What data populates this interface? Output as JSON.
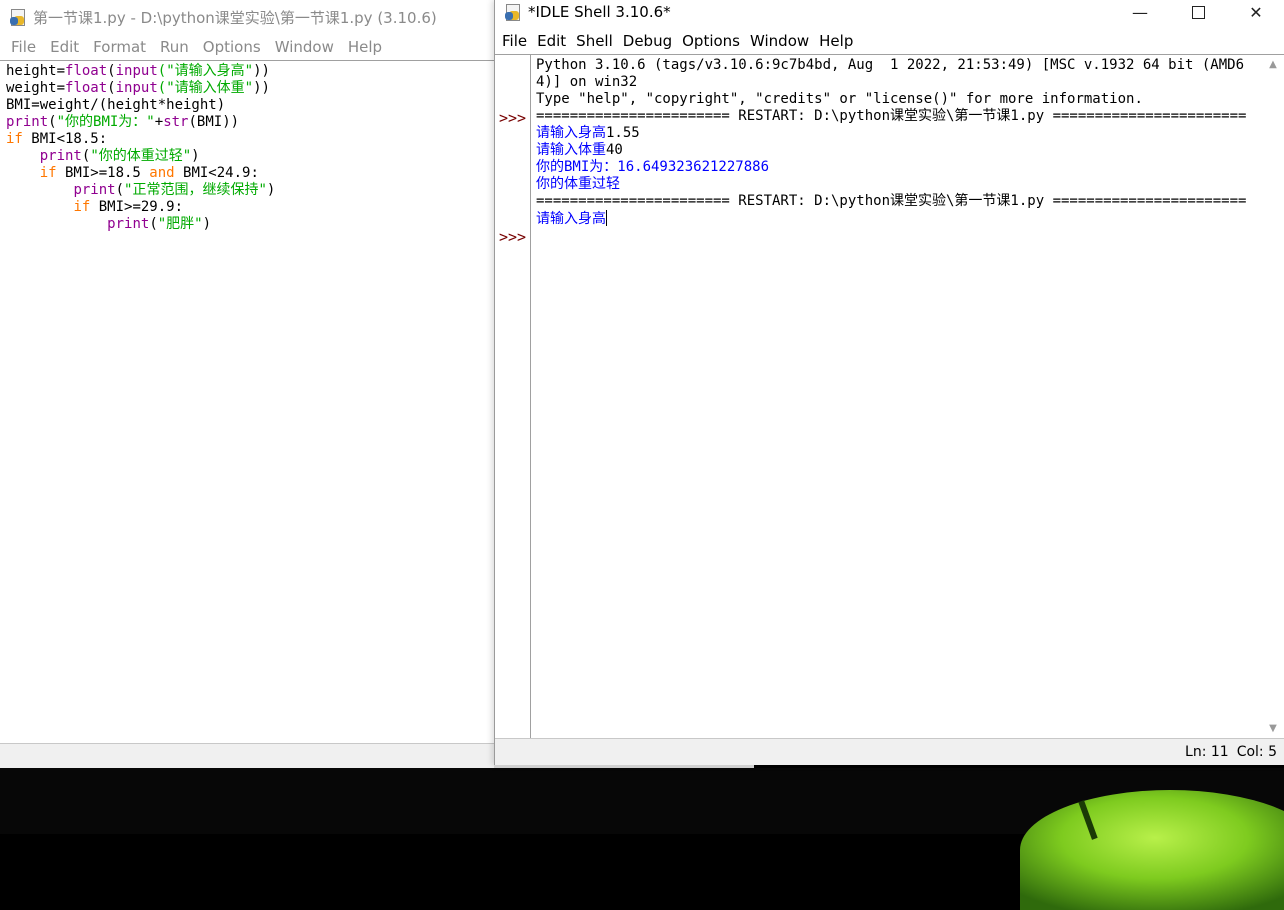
{
  "editor": {
    "title": "第一节课1.py - D:\\python课堂实验\\第一节课1.py (3.10.6)",
    "menu": [
      "File",
      "Edit",
      "Format",
      "Run",
      "Options",
      "Window",
      "Help"
    ],
    "code_lines": [
      [
        {
          "t": "height="
        },
        {
          "t": "float",
          "c": "bi"
        },
        {
          "t": "("
        },
        {
          "t": "input",
          "c": "bi"
        },
        {
          "t": "(\"请输入身高\"",
          "c": "st"
        },
        {
          "t": "))"
        }
      ],
      [
        {
          "t": "weight="
        },
        {
          "t": "float",
          "c": "bi"
        },
        {
          "t": "("
        },
        {
          "t": "input",
          "c": "bi"
        },
        {
          "t": "(\"请输入体重\"",
          "c": "st"
        },
        {
          "t": "))"
        }
      ],
      [
        {
          "t": "BMI=weight/(height*height)"
        }
      ],
      [
        {
          "t": "print",
          "c": "bi"
        },
        {
          "t": "("
        },
        {
          "t": "\"你的BMI为：\"",
          "c": "st"
        },
        {
          "t": "+"
        },
        {
          "t": "str",
          "c": "bi"
        },
        {
          "t": "(BMI))"
        }
      ],
      [
        {
          "t": "if",
          "c": "kw"
        },
        {
          "t": " BMI<18.5:"
        }
      ],
      [
        {
          "t": "    "
        },
        {
          "t": "print",
          "c": "bi"
        },
        {
          "t": "("
        },
        {
          "t": "\"你的体重过轻\"",
          "c": "st"
        },
        {
          "t": ")"
        }
      ],
      [
        {
          "t": "    "
        },
        {
          "t": "if",
          "c": "kw"
        },
        {
          "t": " BMI>=18.5 "
        },
        {
          "t": "and",
          "c": "kw"
        },
        {
          "t": " BMI<24.9:"
        }
      ],
      [
        {
          "t": "        "
        },
        {
          "t": "print",
          "c": "bi"
        },
        {
          "t": "("
        },
        {
          "t": "\"正常范围，继续保持\"",
          "c": "st"
        },
        {
          "t": ")"
        }
      ],
      [
        {
          "t": "        "
        },
        {
          "t": "if",
          "c": "kw"
        },
        {
          "t": " BMI>=29.9:"
        }
      ],
      [
        {
          "t": "            "
        },
        {
          "t": "print",
          "c": "bi"
        },
        {
          "t": "("
        },
        {
          "t": "\"肥胖\"",
          "c": "st"
        },
        {
          "t": ")"
        }
      ]
    ]
  },
  "shell": {
    "title": "*IDLE Shell 3.10.6*",
    "menu": [
      "File",
      "Edit",
      "Shell",
      "Debug",
      "Options",
      "Window",
      "Help"
    ],
    "prompt": ">>>",
    "lines": [
      {
        "t": "Python 3.10.6 (tags/v3.10.6:9c7b4bd, Aug  1 2022, 21:53:49) [MSC v.1932 64 bit (AMD64)] on win32"
      },
      {
        "t": "Type \"help\", \"copyright\", \"credits\" or \"license()\" for more information."
      },
      {
        "t": "======================= RESTART: D:\\python课堂实验\\第一节课1.py ======================="
      },
      {
        "t": "请输入身高",
        "c": "out",
        "tail": "1.55"
      },
      {
        "t": "请输入体重",
        "c": "out",
        "tail": "40"
      },
      {
        "t": "你的BMI为：16.649323621227886",
        "c": "out"
      },
      {
        "t": "你的体重过轻",
        "c": "out"
      },
      {
        "t": "======================= RESTART: D:\\python课堂实验\\第一节课1.py ======================="
      },
      {
        "t": "请输入身高",
        "c": "out",
        "caret": true
      }
    ],
    "status": {
      "line": "Ln: 11",
      "col": "Col: 5"
    }
  },
  "window_controls": {
    "minimize": "—",
    "close": "✕"
  }
}
